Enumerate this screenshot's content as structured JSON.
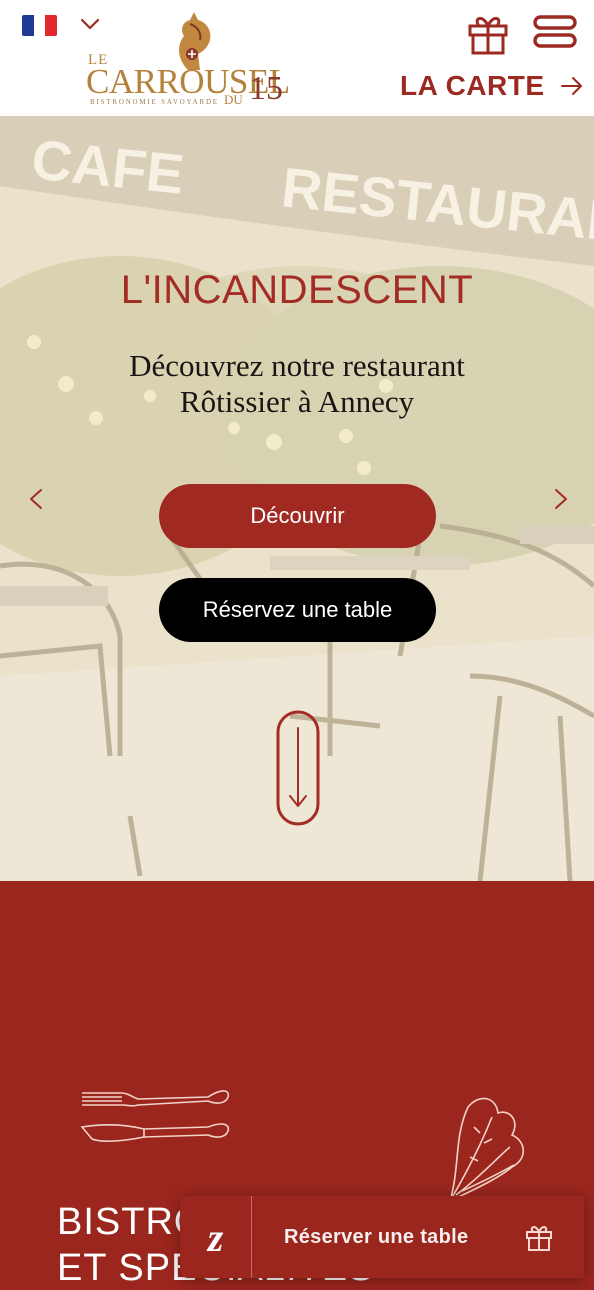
{
  "header": {
    "language": {
      "flag_colors": [
        "#1f3a93",
        "#ffffff",
        "#e0282e"
      ],
      "icon": "chevron-down-icon"
    },
    "logo": {
      "le": "LE",
      "name": "CARROUSEL",
      "du": "DU",
      "number": "15",
      "tagline": "BISTRONOMIE SAVOYARDE"
    },
    "gift_icon": "gift-icon",
    "menu_icon": "hamburger-menu-icon",
    "carte_label": "LA CARTE",
    "carte_icon": "arrow-right-icon"
  },
  "hero": {
    "background_words": [
      "CAFE",
      "RESTAURANT"
    ],
    "title": "L'INCANDESCENT",
    "subtitle_lines": [
      "Découvrez notre restaurant",
      "Rôtissier à Annecy"
    ],
    "discover_label": "Découvrir",
    "reserve_label": "Réservez une table",
    "prev_icon": "chevron-left-icon",
    "next_icon": "chevron-right-icon",
    "scroll_icon": "scroll-down-arrow-icon"
  },
  "section": {
    "title_lines": [
      "BISTRO",
      "ET SPÉCIALITÉS"
    ],
    "icons": [
      "fork-knife-icon",
      "leaf-icon"
    ]
  },
  "float_bar": {
    "brand_letter": "z",
    "reserve_label": "Réserver une table",
    "gift_icon": "gift-icon"
  },
  "colors": {
    "brand_red": "#9a261d",
    "gold": "#b4823a",
    "hero_overlay": "#ece3cd"
  }
}
